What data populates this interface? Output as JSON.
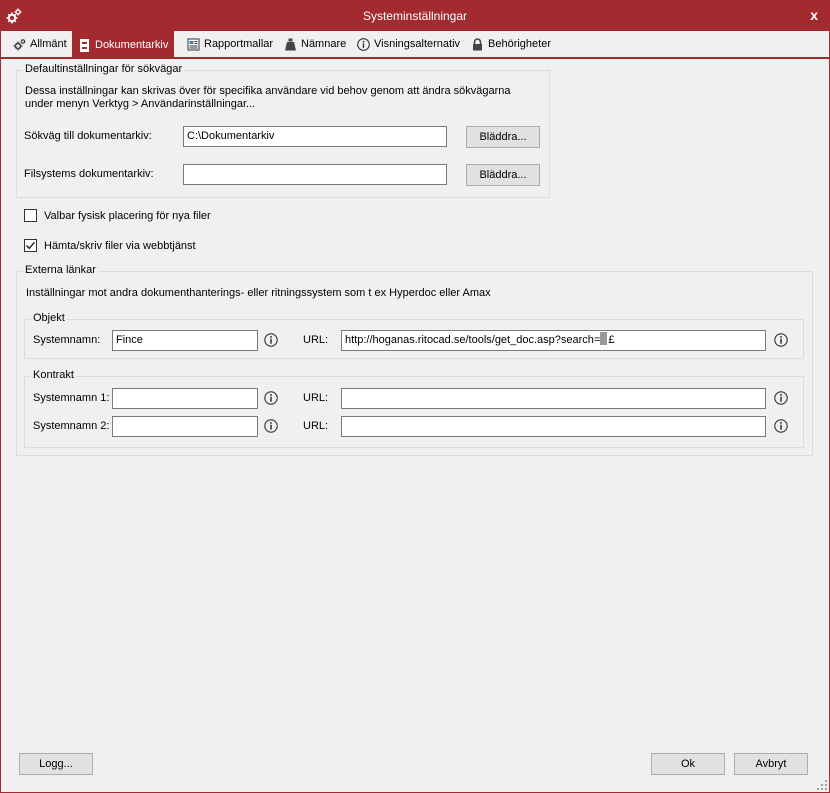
{
  "window": {
    "title": "Systeminställningar",
    "close_symbol": "x",
    "accent_color": "#a32a2e"
  },
  "tabs": [
    {
      "label": "Allmänt",
      "icon": "gears-icon",
      "active": false
    },
    {
      "label": "Dokumentarkiv",
      "icon": "archive-icon",
      "active": true
    },
    {
      "label": "Rapportmallar",
      "icon": "report-icon",
      "active": false
    },
    {
      "label": "Nämnare",
      "icon": "weight-icon",
      "active": false
    },
    {
      "label": "Visningsalternativ",
      "icon": "info-icon",
      "active": false
    },
    {
      "label": "Behörigheter",
      "icon": "lock-icon",
      "active": false
    }
  ],
  "defaults": {
    "legend": "Defaultinställningar för sökvägar",
    "description_line1": "Dessa inställningar kan skrivas över för specifika användare vid behov genom att ändra sökvägarna",
    "description_line2": "under menyn Verktyg > Användarinställningar...",
    "archive_path": {
      "label": "Sökväg till dokumentarkiv:",
      "value": "C:\\Dokumentarkiv",
      "browse_label": "Bläddra..."
    },
    "fs_archive": {
      "label": "Filsystems dokumentarkiv:",
      "value": "",
      "browse_label": "Bläddra..."
    }
  },
  "options": {
    "physical_placement": {
      "label": "Valbar fysisk placering för nya filer",
      "checked": false
    },
    "web_service": {
      "label": "Hämta/skriv filer via webbtjänst",
      "checked": true
    }
  },
  "external_links": {
    "legend": "Externa länkar",
    "description": "Inställningar mot andra dokumenthanterings-  eller ritningssystem som t ex Hyperdoc eller Amax",
    "object": {
      "legend": "Objekt",
      "system_label": "Systemnamn:",
      "system_value": "Fince",
      "url_label": "URL:",
      "url_value": "http://hoganas.ritocad.se/tools/get_doc.asp?search=",
      "url_suffix": "£"
    },
    "contract": {
      "legend": "Kontrakt",
      "system1_label": "Systemnamn 1:",
      "system1_value": "",
      "system2_label": "Systemnamn 2:",
      "system2_value": "",
      "url_label": "URL:",
      "url1_value": "",
      "url2_value": ""
    }
  },
  "footer": {
    "log_label": "Logg...",
    "ok_label": "Ok",
    "cancel_label": "Avbryt"
  }
}
